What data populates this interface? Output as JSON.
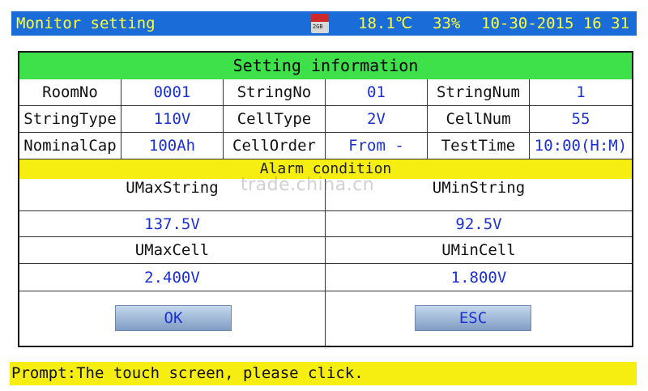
{
  "header": {
    "title": "Monitor setting",
    "temperature": "18.1℃",
    "humidity": "33%",
    "datetime": "10-30-2015 16 31",
    "sd_card_text": "2GB"
  },
  "setting_info": {
    "title": "Setting information",
    "rows": [
      [
        {
          "label": "RoomNo",
          "value": "0001"
        },
        {
          "label": "StringNo",
          "value": "01"
        },
        {
          "label": "StringNum",
          "value": "1"
        }
      ],
      [
        {
          "label": "StringType",
          "value": "110V"
        },
        {
          "label": "CellType",
          "value": "2V"
        },
        {
          "label": "CellNum",
          "value": "55"
        }
      ],
      [
        {
          "label": "NominalCap",
          "value": "100Ah"
        },
        {
          "label": "CellOrder",
          "value": "From -"
        },
        {
          "label": "TestTime",
          "value": "10:00(H:M)"
        }
      ]
    ]
  },
  "alarm": {
    "title": "Alarm condition",
    "umax_string_label": "UMaxString",
    "umin_string_label": "UMinString",
    "umax_string_value": "137.5V",
    "umin_string_value": "92.5V",
    "umax_cell_label": "UMaxCell",
    "umin_cell_label": "UMinCell",
    "umax_cell_value": "2.400V",
    "umin_cell_value": "1.800V"
  },
  "buttons": {
    "ok": "OK",
    "esc": "ESC"
  },
  "watermark": "trade.china.cn",
  "prompt": "Prompt:The touch screen, please click."
}
